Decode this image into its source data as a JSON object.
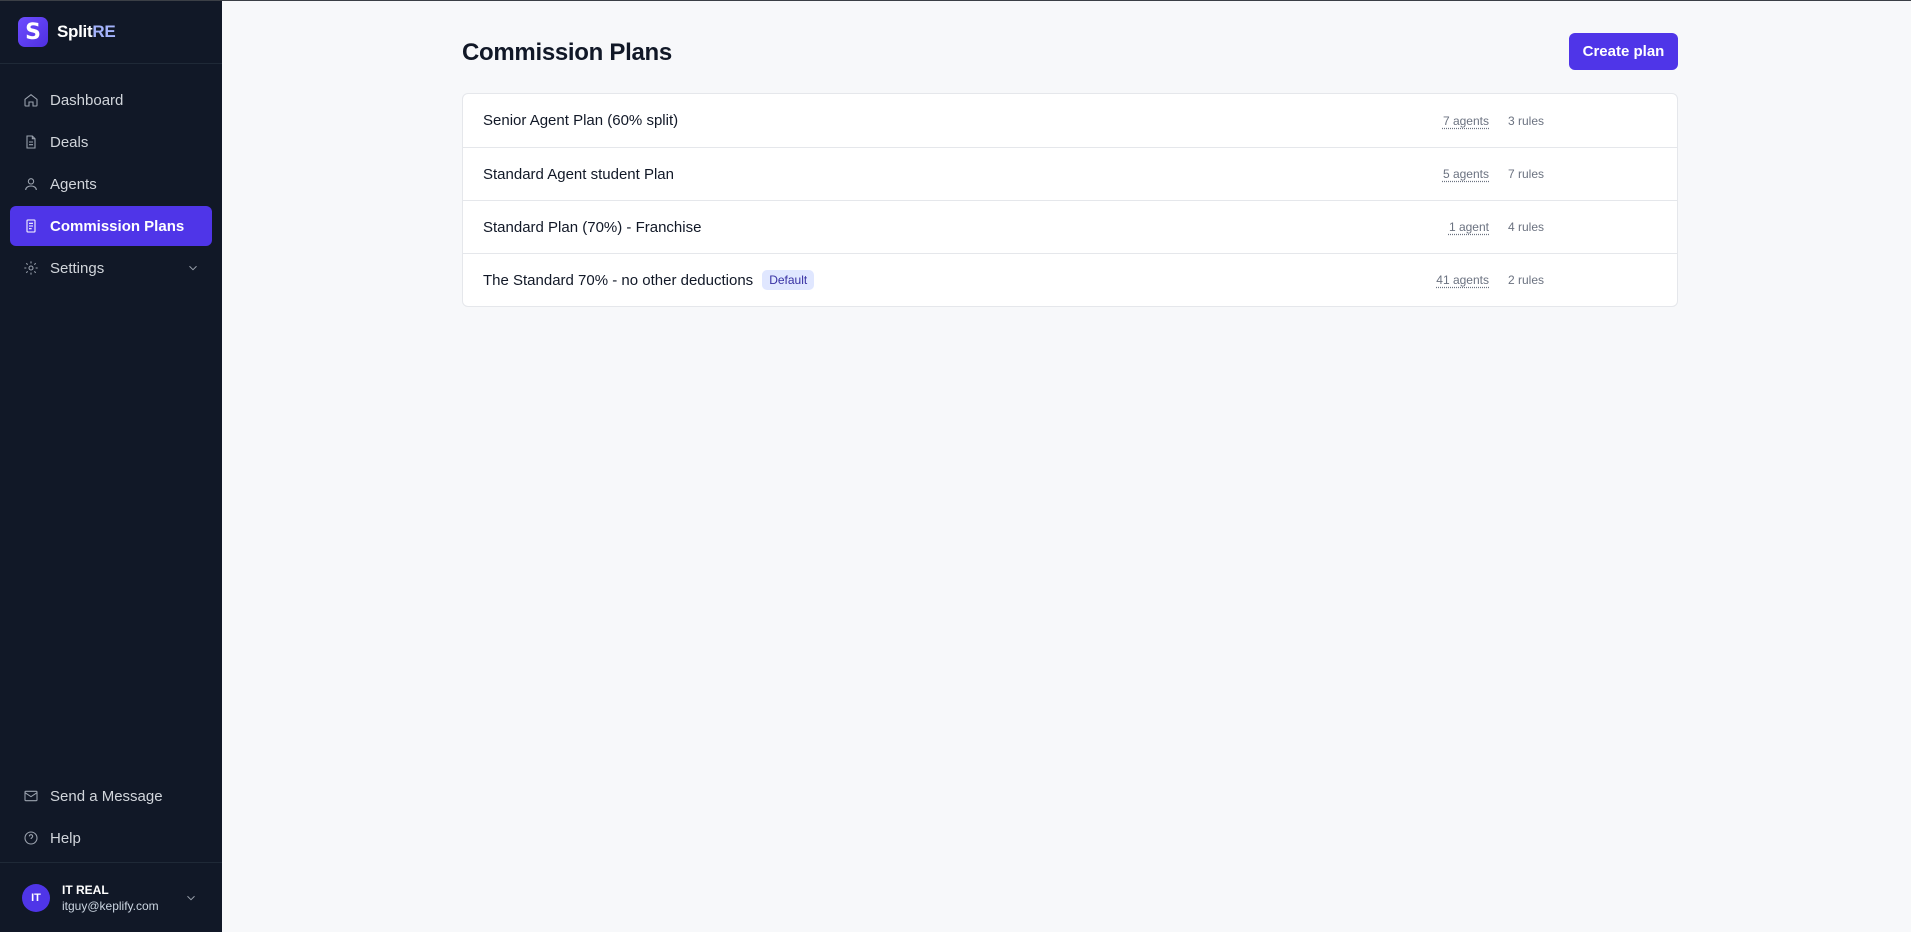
{
  "brand": {
    "logo_letter": "S",
    "name_main": "Split",
    "name_accent": "RE"
  },
  "sidebar": {
    "items": [
      {
        "label": "Dashboard",
        "icon": "home-icon",
        "active": false
      },
      {
        "label": "Deals",
        "icon": "document-icon",
        "active": false
      },
      {
        "label": "Agents",
        "icon": "user-icon",
        "active": false
      },
      {
        "label": "Commission Plans",
        "icon": "clipboard-icon",
        "active": true
      },
      {
        "label": "Settings",
        "icon": "gear-icon",
        "active": false
      }
    ],
    "bottom_items": [
      {
        "label": "Send a Message",
        "icon": "mail-icon"
      },
      {
        "label": "Help",
        "icon": "help-circle-icon"
      }
    ],
    "user": {
      "initials": "IT",
      "name": "IT REAL",
      "email": "itguy@keplify.com"
    }
  },
  "main": {
    "title": "Commission Plans",
    "create_button": "Create plan",
    "plans": [
      {
        "name": "Senior Agent Plan (60% split)",
        "agents": "7 agents",
        "rules": "3 rules",
        "badge": ""
      },
      {
        "name": "Standard Agent student Plan",
        "agents": "5 agents",
        "rules": "7 rules",
        "badge": ""
      },
      {
        "name": "Standard Plan (70%) - Franchise",
        "agents": "1 agent",
        "rules": "4 rules",
        "badge": ""
      },
      {
        "name": "The Standard 70% - no other deductions",
        "agents": "41 agents",
        "rules": "2 rules",
        "badge": "Default"
      }
    ]
  },
  "colors": {
    "accent": "#4f35e8",
    "sidebar_bg": "#111827",
    "page_bg": "#f7f8fa"
  }
}
